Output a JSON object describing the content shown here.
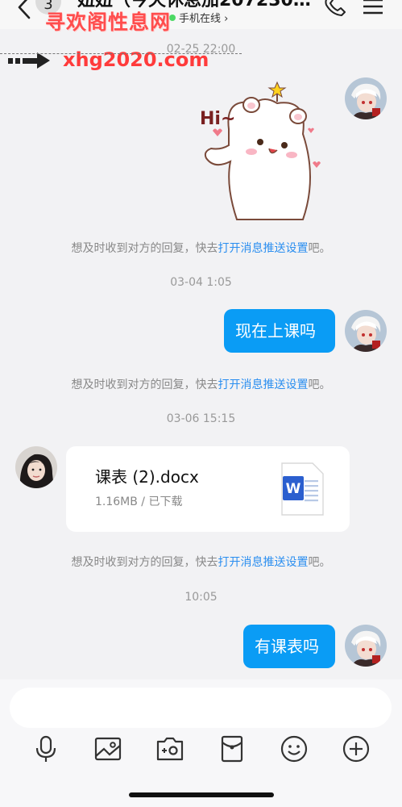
{
  "header": {
    "unread_count": "3",
    "title": "妞妞（今天休息加207230…",
    "status": "手机在线 ›"
  },
  "watermark": {
    "text": "寻欢阁性息网",
    "domain": "xhg2020.com"
  },
  "messages": {
    "ts1": "02-25 22:00",
    "notice1_prefix": "想及时收到对方的回复，快去",
    "notice1_link": "打开消息推送设置",
    "notice1_suffix": "吧。",
    "ts2": "03-04 1:05",
    "msg_class_now": "现在上课吗",
    "notice2_prefix": "想及时收到对方的回复，快去",
    "notice2_link": "打开消息推送设置",
    "notice2_suffix": "吧。",
    "ts3": "03-06 15:15",
    "file_name": "课表 (2).docx",
    "file_meta": "1.16MB / 已下载",
    "notice3_prefix": "想及时收到对方的回复，快去",
    "notice3_link": "打开消息推送设置",
    "notice3_suffix": "吧。",
    "ts4": "10:05",
    "msg_schedule": "有课表吗",
    "sticker_text": "Hi~"
  },
  "input": {
    "placeholder": ""
  },
  "colors": {
    "bubble": "#0a9cf5",
    "link": "#2a8ef0",
    "watermark": "#ff4d4d"
  },
  "icons": [
    "chevron-left-icon",
    "phone-icon",
    "menu-icon",
    "microphone-icon",
    "image-icon",
    "camera-icon",
    "red-packet-icon",
    "emoji-icon",
    "plus-icon",
    "word-doc-icon"
  ]
}
